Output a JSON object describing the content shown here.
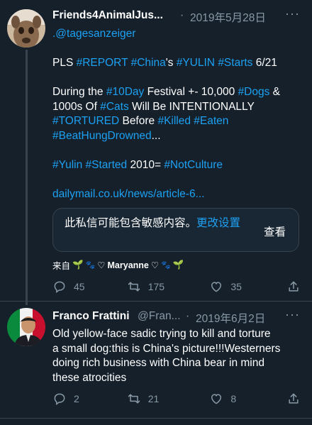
{
  "tweet1": {
    "display_name": "Friends4AnimalJus...",
    "date": "2019年5月28日",
    "reply_to": ".@tagesanzeiger",
    "line1": [
      {
        "t": "PLS ",
        "link": false
      },
      {
        "t": "#REPORT",
        "link": true
      },
      {
        "t": " ",
        "link": false
      },
      {
        "t": "#China",
        "link": true
      },
      {
        "t": "'s ",
        "link": false
      },
      {
        "t": "#YULIN",
        "link": true
      },
      {
        "t": " ",
        "link": false
      },
      {
        "t": "#Starts",
        "link": true
      },
      {
        "t": " 6/21",
        "link": false
      }
    ],
    "para2_line1": [
      {
        "t": "During the ",
        "link": false
      },
      {
        "t": "#10Day",
        "link": true
      },
      {
        "t": " Festival +- 10,000 ",
        "link": false
      },
      {
        "t": "#Dogs",
        "link": true
      },
      {
        "t": " &",
        "link": false
      }
    ],
    "para2_line2": [
      {
        "t": "1000s Of ",
        "link": false
      },
      {
        "t": "#Cats",
        "link": true
      },
      {
        "t": " Will Be INTENTIONALLY",
        "link": false
      }
    ],
    "para2_line3": [
      {
        "t": "#TORTURED",
        "link": true
      },
      {
        "t": " Before ",
        "link": false
      },
      {
        "t": "#Killed",
        "link": true
      },
      {
        "t": " ",
        "link": false
      },
      {
        "t": "#Eaten",
        "link": true
      }
    ],
    "para2_line4": [
      {
        "t": "#BeatHungDrowned",
        "link": true
      },
      {
        "t": "...",
        "link": false
      }
    ],
    "para3": [
      {
        "t": "#Yulin",
        "link": true
      },
      {
        "t": " ",
        "link": false
      },
      {
        "t": "#Started",
        "link": true
      },
      {
        "t": " 2010= ",
        "link": false
      },
      {
        "t": "#NotCulture",
        "link": true
      }
    ],
    "url": "dailymail.co.uk/news/article-6...",
    "sensitive_notice": "此私信可能包含敏感内容。",
    "change_settings": "更改设置",
    "view_label": "查看",
    "via_prefix": "来自",
    "via_name": "Maryanne",
    "replies": "45",
    "retweets": "175",
    "likes": "35"
  },
  "tweet2": {
    "display_name": "Franco Frattini",
    "handle": "@Fran...",
    "date": "2019年6月2日",
    "text_lines": [
      "Old yellow-face sadic trying to kill and torture",
      "a small dog:this is China's picture!!!Westerners",
      "doing rich business with China bear in mind",
      "these atrocities"
    ],
    "replies": "2",
    "retweets": "21",
    "likes": "8"
  },
  "colors": {
    "background": "#15202b",
    "link": "#1da1f2",
    "muted": "#8899a6",
    "border": "#38444d"
  }
}
